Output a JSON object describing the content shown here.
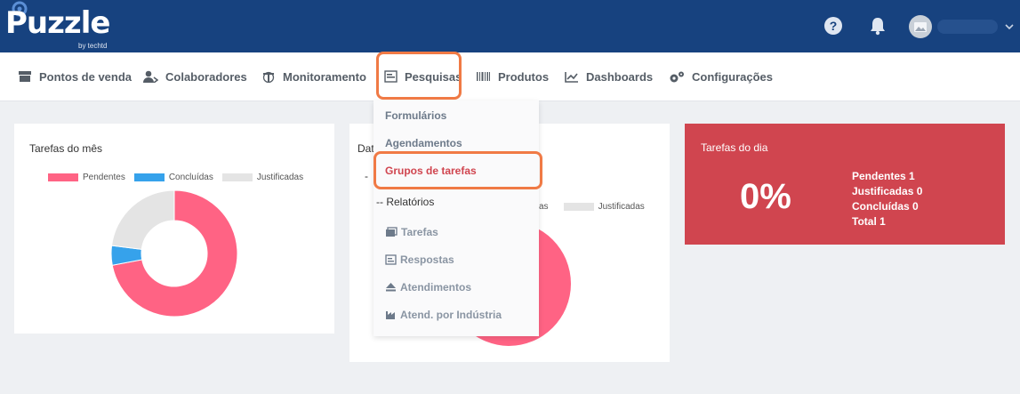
{
  "header": {
    "logo_text": "Puzzle",
    "logo_sub": "by techtd",
    "colors": {
      "topbar": "#17427f",
      "accent": "#f07a45"
    }
  },
  "nav": {
    "items": [
      {
        "label": "Pontos de venda",
        "icon": "store-icon"
      },
      {
        "label": "Colaboradores",
        "icon": "users-icon"
      },
      {
        "label": "Monitoramento",
        "icon": "monitor-icon"
      },
      {
        "label": "Pesquisas",
        "icon": "form-icon"
      },
      {
        "label": "Produtos",
        "icon": "barcode-icon"
      },
      {
        "label": "Dashboards",
        "icon": "chart-line-icon"
      },
      {
        "label": "Configurações",
        "icon": "gears-icon"
      }
    ]
  },
  "dropdown": {
    "items": [
      {
        "label": "Formulários"
      },
      {
        "label": "Agendamentos"
      },
      {
        "label": "Grupos de tarefas"
      }
    ],
    "section": "-- Relatórios",
    "subitems": [
      {
        "label": "Tarefas",
        "icon": "images-icon"
      },
      {
        "label": "Respostas",
        "icon": "form-icon"
      },
      {
        "label": "Atendimentos",
        "icon": "eject-icon"
      },
      {
        "label": "Atend. por Indústria",
        "icon": "industry-icon"
      }
    ]
  },
  "cards": {
    "month": {
      "title": "Tarefas do mês"
    },
    "date": {
      "title_fragment": "Dat",
      "dash": "-",
      "legend_fragment": "as"
    },
    "day": {
      "title": "Tarefas do dia",
      "percent": "0%",
      "pendentes": "Pendentes 1",
      "justificadas": "Justificadas 0",
      "concluidas": "Concluídas 0",
      "total": "Total 1",
      "color": "#d0454f"
    }
  },
  "chart_data": [
    {
      "type": "pie",
      "categories": [
        "Pendentes",
        "Concluídas",
        "Justificadas"
      ],
      "values": [
        72,
        5,
        23
      ],
      "colors": [
        "#ff6384",
        "#36a2eb",
        "#e4e4e4"
      ],
      "legend": "top"
    },
    {
      "type": "pie",
      "categories": [
        "Justificadas"
      ],
      "legend_visible": [
        "Justificadas"
      ],
      "colors": [
        "#ff6384",
        "#e4e4e4"
      ]
    }
  ]
}
